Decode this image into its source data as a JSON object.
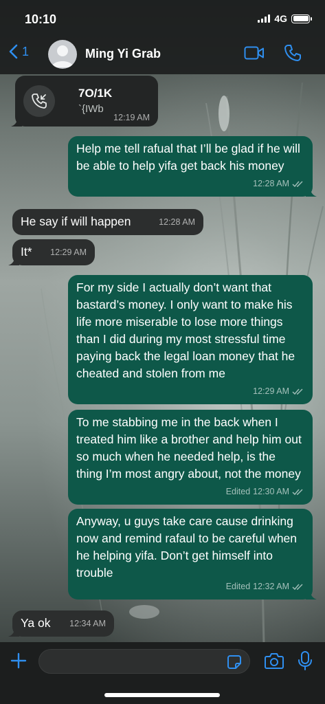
{
  "status": {
    "time": "10:10",
    "network": "4G"
  },
  "header": {
    "back_count": "1",
    "contact_name": "Ming Yi Grab"
  },
  "call": {
    "title": "7O/1K",
    "subtitle": "`{IWb",
    "time": "12:19 AM"
  },
  "messages": [
    {
      "dir": "out",
      "text": "Help me tell rafual that I’ll be glad if he will be able to help yifa get back his money",
      "time": "12:28 AM",
      "edited": ""
    },
    {
      "dir": "in",
      "text": "He say if will happen",
      "time": "12:28 AM",
      "edited": ""
    },
    {
      "dir": "in",
      "text": "It*",
      "time": "12:29 AM",
      "edited": ""
    },
    {
      "dir": "out",
      "text": "For my side I actually don’t want that bastard’s money. I only want to make his life more miserable to lose more things than I did during my most stressful time paying back the legal loan money that he cheated and stolen from me",
      "time": "12:29 AM",
      "edited": ""
    },
    {
      "dir": "out",
      "text": "To me stabbing me in the back when I treated him like a brother and help him out so much when he needed help, is the thing I’m most angry about, not the money",
      "time": "12:30 AM",
      "edited": "Edited"
    },
    {
      "dir": "out",
      "text": "Anyway, u guys take care cause drinking now and remind rafaul to be careful when he helping yifa. Don’t get himself into trouble",
      "time": "12:32 AM",
      "edited": "Edited"
    },
    {
      "dir": "in",
      "text": "Ya ok",
      "time": "12:34 AM",
      "edited": ""
    }
  ],
  "icons": {
    "back": "chevron-left-icon",
    "video": "video-call-icon",
    "phone": "phone-icon",
    "call": "incoming-call-icon",
    "plus": "plus-icon",
    "sticker": "sticker-icon",
    "camera": "camera-icon",
    "mic": "microphone-icon",
    "read": "double-check-icon"
  },
  "colors": {
    "accent": "#2f8ff0",
    "outgoing": "#0e5849",
    "incoming": "#2c2e2e"
  }
}
